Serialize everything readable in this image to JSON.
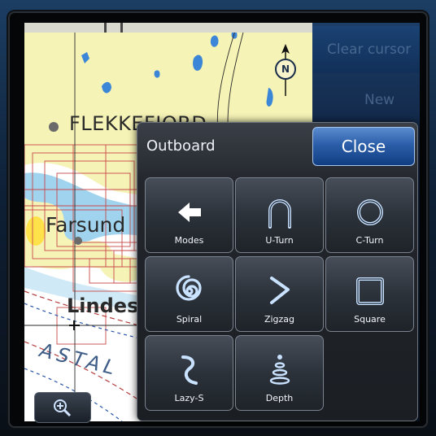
{
  "map": {
    "labels": {
      "flekkefjord": "FLEKKEFJORD",
      "farsund": "Farsund",
      "lindesnes": "Lindes",
      "kystal": "ASTAL"
    },
    "north_label": "N",
    "colors": {
      "land": "#f5f3b6",
      "water": "#ffffff",
      "shallow": "#9fd3ee",
      "lake": "#3c86d8"
    }
  },
  "side_menu": {
    "items": [
      "Clear cursor",
      "New"
    ]
  },
  "dialog": {
    "title": "Outboard",
    "close_label": "Close",
    "tiles": [
      {
        "label": "Modes",
        "icon": "arrow-left-icon"
      },
      {
        "label": "U-Turn",
        "icon": "u-turn-icon"
      },
      {
        "label": "C-Turn",
        "icon": "c-turn-icon"
      },
      {
        "label": "Spiral",
        "icon": "spiral-icon"
      },
      {
        "label": "Zigzag",
        "icon": "zigzag-icon"
      },
      {
        "label": "Square",
        "icon": "square-icon"
      },
      {
        "label": "Lazy-S",
        "icon": "lazy-s-icon"
      },
      {
        "label": "Depth",
        "icon": "depth-icon"
      }
    ]
  }
}
